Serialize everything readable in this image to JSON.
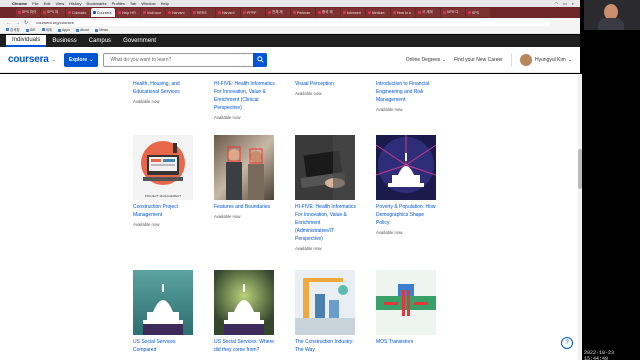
{
  "menubar": {
    "app": "Chrome",
    "items": [
      "File",
      "Edit",
      "View",
      "History",
      "Bookmarks",
      "Profiles",
      "Tab",
      "Window",
      "Help"
    ]
  },
  "tabs": [
    {
      "label": "SPS 파이"
    },
    {
      "label": "SPS 파"
    },
    {
      "label": "Colorado"
    },
    {
      "label": "Coursera"
    },
    {
      "label": "Help HFI"
    },
    {
      "label": "Visit cour"
    },
    {
      "label": "Harvard"
    },
    {
      "label": "RFRS"
    },
    {
      "label": "Harvard"
    },
    {
      "label": "PPPP"
    },
    {
      "label": "전체 제"
    },
    {
      "label": "Perlman"
    },
    {
      "label": "중국 제"
    },
    {
      "label": "Informed"
    },
    {
      "label": "Medium"
    },
    {
      "label": "How to a"
    },
    {
      "label": "서 세계"
    },
    {
      "label": "NPR 다"
    },
    {
      "label": "SPS"
    }
  ],
  "address": {
    "url": "coursera.org/courses"
  },
  "bookmarks": [
    "검색창",
    "IDE",
    "세계",
    "Apps",
    "About",
    "News"
  ],
  "topnav": {
    "items": [
      "Individuals",
      "Business",
      "Campus",
      "Government"
    ]
  },
  "header": {
    "logo": "coursera",
    "explore": "Explore",
    "search_placeholder": "What do you want to learn?",
    "online_degrees": "Online Degrees",
    "career": "Find your New Career",
    "user": "Hyungyul Kim"
  },
  "cards": [
    {
      "title": "Health, Housing, and Educational Services",
      "status": "Available now"
    },
    {
      "title": "HI-FIVE: Health Informatics For Innovation, Value & Enrichment (Clinical Perspective)",
      "status": "Available now"
    },
    {
      "title": "Visual Perception",
      "status": "Available now"
    },
    {
      "title": "Introduction to Financial Engineering and Risk Management",
      "status": "Available now"
    },
    {
      "title": "Construction Project Management",
      "status": "Available now",
      "thumb_caption": "PROJECT MANAGEMENT"
    },
    {
      "title": "Features and Boundaries",
      "status": "Available now"
    },
    {
      "title": "HI-FIVE: Health Informatics For Innovation, Value & Enrichment (Administrative/IT Perspective)",
      "status": "Available now"
    },
    {
      "title": "Poverty & Population: How Demographics Shape Policy",
      "status": "Available now"
    },
    {
      "title": "US Social Services Compared",
      "status": ""
    },
    {
      "title": "US Social Services: Where did they come from?",
      "status": ""
    },
    {
      "title": "The Construction Industry: The Way",
      "status": ""
    },
    {
      "title": "MOS Transistors",
      "status": ""
    }
  ],
  "clock": "2022-10-23  15:44:49",
  "colors": {
    "brand": "#0056d2",
    "tabbar": "#6e2727"
  }
}
